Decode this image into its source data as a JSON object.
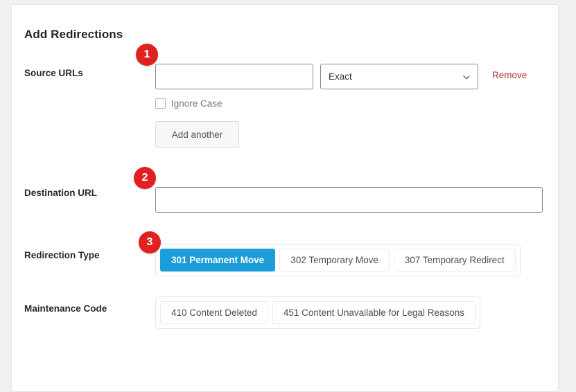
{
  "card": {
    "title": "Add Redirections"
  },
  "rows": {
    "source": {
      "label": "Source URLs",
      "url_value": "",
      "url_placeholder": "",
      "match_type": "Exact",
      "remove_label": "Remove",
      "ignore_case_label": "Ignore Case",
      "ignore_case_checked": false,
      "add_another_label": "Add another"
    },
    "destination": {
      "label": "Destination URL",
      "value": "",
      "placeholder": ""
    },
    "redirection_type": {
      "label": "Redirection Type",
      "options": [
        {
          "label": "301 Permanent Move",
          "active": true
        },
        {
          "label": "302 Temporary Move",
          "active": false
        },
        {
          "label": "307 Temporary Redirect",
          "active": false
        }
      ]
    },
    "maintenance_code": {
      "label": "Maintenance Code",
      "options": [
        {
          "label": "410 Content Deleted",
          "active": false
        },
        {
          "label": "451 Content Unavailable for Legal Reasons",
          "active": false
        }
      ]
    }
  },
  "badges": [
    {
      "number": "1"
    },
    {
      "number": "2"
    },
    {
      "number": "3"
    }
  ],
  "colors": {
    "badge_red": "#e0211f",
    "active_blue": "#1b9dd9",
    "remove_red": "#b32d2e",
    "page_background": "#f0f0f1",
    "card_background": "#ffffff"
  }
}
